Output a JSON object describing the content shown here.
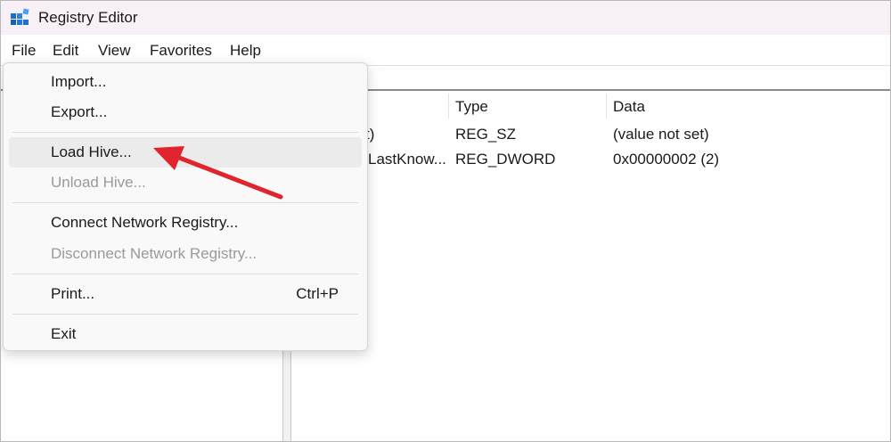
{
  "window": {
    "title": "Registry Editor"
  },
  "menubar": {
    "items": [
      {
        "label": "File"
      },
      {
        "label": "Edit"
      },
      {
        "label": "View"
      },
      {
        "label": "Favorites"
      },
      {
        "label": "Help"
      }
    ]
  },
  "list": {
    "columns": {
      "type": "Type",
      "data": "Data"
    },
    "rows": [
      {
        "name": "t)",
        "type": "REG_SZ",
        "data": "(value not set)"
      },
      {
        "name": "LastKnow...",
        "type": "REG_DWORD",
        "data": "0x00000002 (2)"
      }
    ]
  },
  "file_menu": {
    "import": "Import...",
    "export": "Export...",
    "load_hive": "Load Hive...",
    "unload_hive": "Unload Hive...",
    "connect": "Connect Network Registry...",
    "disconnect": "Disconnect Network Registry...",
    "print": "Print...",
    "print_shortcut": "Ctrl+P",
    "exit": "Exit",
    "hovered_item": "Load Hive...",
    "disabled_items": [
      "Unload Hive...",
      "Disconnect Network Registry..."
    ]
  },
  "colors": {
    "titlebar": "#f8f0f7",
    "annotation_arrow": "#e0252e",
    "menu_hover": "#ebebeb",
    "disabled_text": "#9a9a9a"
  },
  "icons": {
    "app": "registry-editor-icon"
  }
}
